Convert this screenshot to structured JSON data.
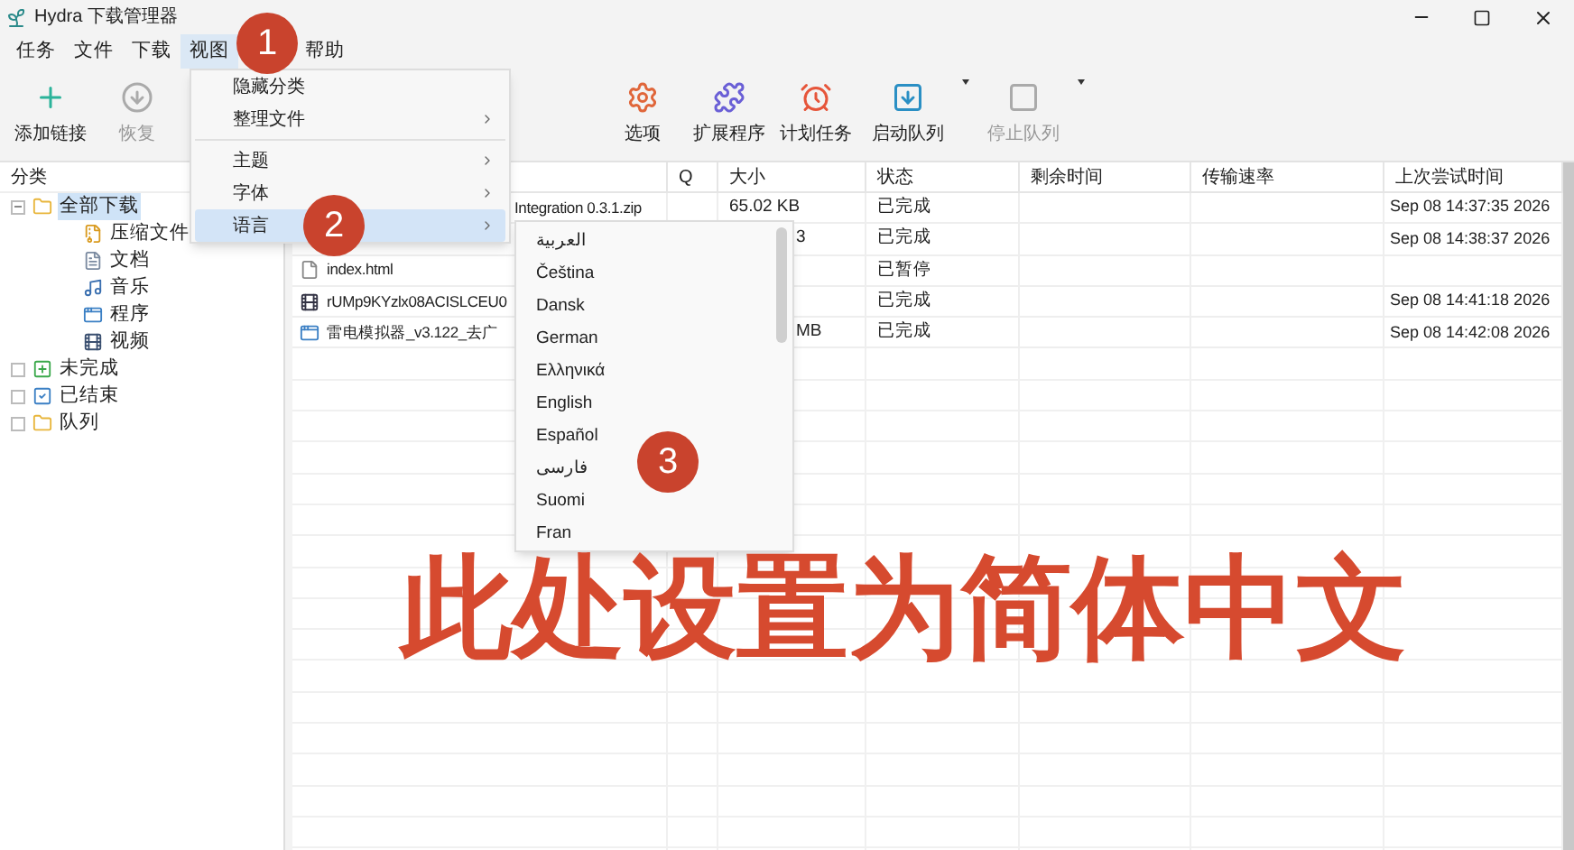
{
  "window": {
    "title": "Hydra 下载管理器"
  },
  "menubar": [
    {
      "label": "任务",
      "selected": false
    },
    {
      "label": "文件",
      "selected": false
    },
    {
      "label": "下载",
      "selected": false
    },
    {
      "label": "视图",
      "selected": true
    },
    {
      "label": "帮助",
      "selected": false
    }
  ],
  "toolbar": [
    {
      "label": "添加链接",
      "kind": "add",
      "disabled": false,
      "dropdown": false
    },
    {
      "label": "恢复",
      "kind": "resume",
      "disabled": true,
      "dropdown": false
    },
    {
      "label": "选项",
      "kind": "options",
      "disabled": false,
      "dropdown": false
    },
    {
      "label": "扩展程序",
      "kind": "extensions",
      "disabled": false,
      "dropdown": false
    },
    {
      "label": "计划任务",
      "kind": "schedule",
      "disabled": false,
      "dropdown": false
    },
    {
      "label": "启动队列",
      "kind": "start_queue",
      "disabled": false,
      "dropdown": true
    },
    {
      "label": "停止队列",
      "kind": "stop_queue",
      "disabled": true,
      "dropdown": true
    }
  ],
  "sidebar": {
    "header": "分类",
    "tree": [
      {
        "label": "全部下载",
        "kind": "folder",
        "expanded": true,
        "selected": true,
        "children": [
          {
            "label": "压缩文件",
            "kind": "archive",
            "selected": false
          },
          {
            "label": "文档",
            "kind": "document",
            "selected": false
          },
          {
            "label": "音乐",
            "kind": "music",
            "selected": false
          },
          {
            "label": "程序",
            "kind": "program",
            "selected": false
          },
          {
            "label": "视频",
            "kind": "video",
            "selected": false
          }
        ]
      },
      {
        "label": "未完成",
        "kind": "incomplete",
        "expanded": false,
        "selected": false
      },
      {
        "label": "已结束",
        "kind": "finished",
        "expanded": false,
        "selected": false
      },
      {
        "label": "队列",
        "kind": "folder",
        "expanded": false,
        "selected": false
      }
    ]
  },
  "table": {
    "columns": [
      "Q",
      "大小",
      "状态",
      "剩余时间",
      "传输速率",
      "上次尝试时间"
    ],
    "rows": [
      {
        "name": "Integration 0.3.1.zip",
        "size": "65.02 KB",
        "status": "已完成",
        "last_try": "Sep 08 14:37:35 2026"
      },
      {
        "size": "3",
        "status": "已完成",
        "last_try": "Sep 08 14:38:37 2026"
      },
      {
        "name": "index.html",
        "kind": "document",
        "status": "已暂停"
      },
      {
        "name": "rUMp9KYzlx08ACISLCEU0",
        "kind": "video",
        "status": "已完成",
        "last_try": "Sep 08 14:41:18 2026"
      },
      {
        "name": "雷电模拟器_v3.122_去广",
        "kind": "program",
        "size": "MB",
        "status": "已完成",
        "last_try": "Sep 08 14:42:08 2026"
      }
    ]
  },
  "view_menu": [
    {
      "label": "隐藏分类",
      "kind": "item",
      "submenu": false,
      "selected": false
    },
    {
      "label": "整理文件",
      "kind": "item",
      "submenu": true,
      "selected": false
    },
    {
      "kind": "separator"
    },
    {
      "label": "主题",
      "kind": "item",
      "submenu": true,
      "selected": false
    },
    {
      "label": "字体",
      "kind": "item",
      "submenu": true,
      "selected": false
    },
    {
      "label": "语言",
      "kind": "item",
      "submenu": true,
      "selected": true
    }
  ],
  "language_menu": [
    "العربية",
    "Čeština",
    "Dansk",
    "German",
    "Ελληνικά",
    "English",
    "Español",
    "فارسی",
    "Suomi",
    "Fran"
  ],
  "annotations": [
    "1",
    "2",
    "3"
  ],
  "caption": "此处设置为简体中文"
}
